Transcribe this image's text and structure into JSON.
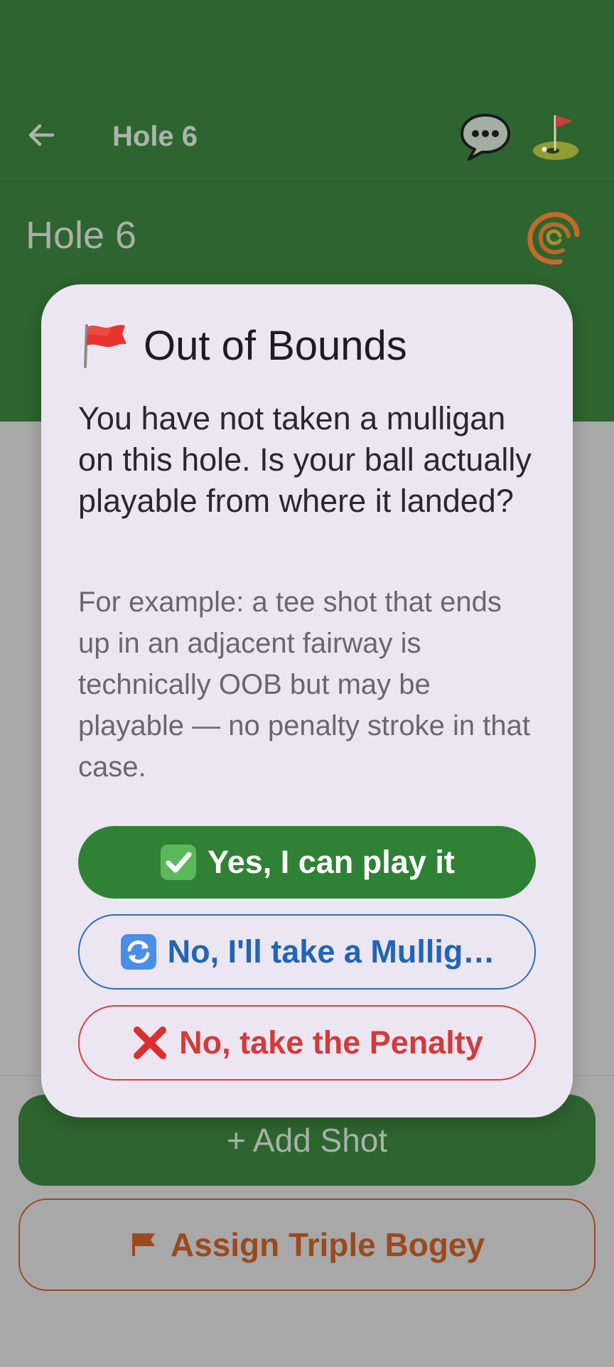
{
  "app_bar": {
    "title": "Hole 6",
    "back_icon": "arrow-left-icon",
    "chat_icon": "speech-bubble-icon",
    "golf_icon": "golf-flag-icon"
  },
  "page": {
    "hole_heading": "Hole 6",
    "add_shot_label": "+ Add Shot",
    "triple_bogey_label": "Assign Triple Bogey",
    "triple_bogey_icon": "flag-icon"
  },
  "dialog": {
    "title": "Out of Bounds",
    "title_icon": "red-flag-icon",
    "question": "You have not taken a mulligan on this hole. Is your ball actually playable from where it landed?",
    "example": "For example: a tee shot that ends up in an adjacent fairway is technically OOB but may be playable — no penalty stroke in that case.",
    "buttons": {
      "yes": "Yes, I can play it",
      "mulligan": "No, I'll take a Mullig…",
      "penalty": "No, take the Penalty"
    }
  },
  "colors": {
    "app_green": "#2d642f",
    "confirm_green": "#2f8234",
    "mulligan_blue": "#2165b6",
    "penalty_red": "#d33a3a",
    "bogey_orange": "#9a4a1d",
    "dialog_bg": "#ece6f2"
  }
}
